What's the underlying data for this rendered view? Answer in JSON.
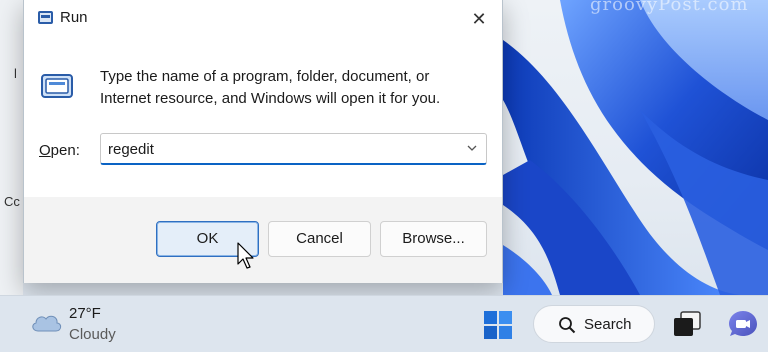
{
  "dialog": {
    "title": "Run",
    "close_label": "✕",
    "description_line1": "Type the name of a program, folder, document, or",
    "description_line2": "Internet resource, and Windows will open it for you.",
    "open_label_mnemonic": "O",
    "open_label_rest": "pen:",
    "open_value": "regedit",
    "buttons": {
      "ok": "OK",
      "cancel": "Cancel",
      "browse": "Browse..."
    }
  },
  "desktop": {
    "watermark": "groovyPost.com",
    "side_text_1": "l",
    "side_text_2": "Cc"
  },
  "taskbar": {
    "weather_temp": "27°F",
    "weather_condition": "Cloudy",
    "search_label": "Search"
  },
  "icons": [
    "run-app-icon",
    "close-icon",
    "chevron-down-icon",
    "mouse-cursor-icon",
    "cloud-weather-icon",
    "windows-start-icon",
    "search-icon",
    "task-view-icon",
    "chat-icon"
  ],
  "colors": {
    "accent": "#0a63c4",
    "wallpaper_blue": "#1f52d6",
    "ok_border": "#2f6fc1"
  }
}
